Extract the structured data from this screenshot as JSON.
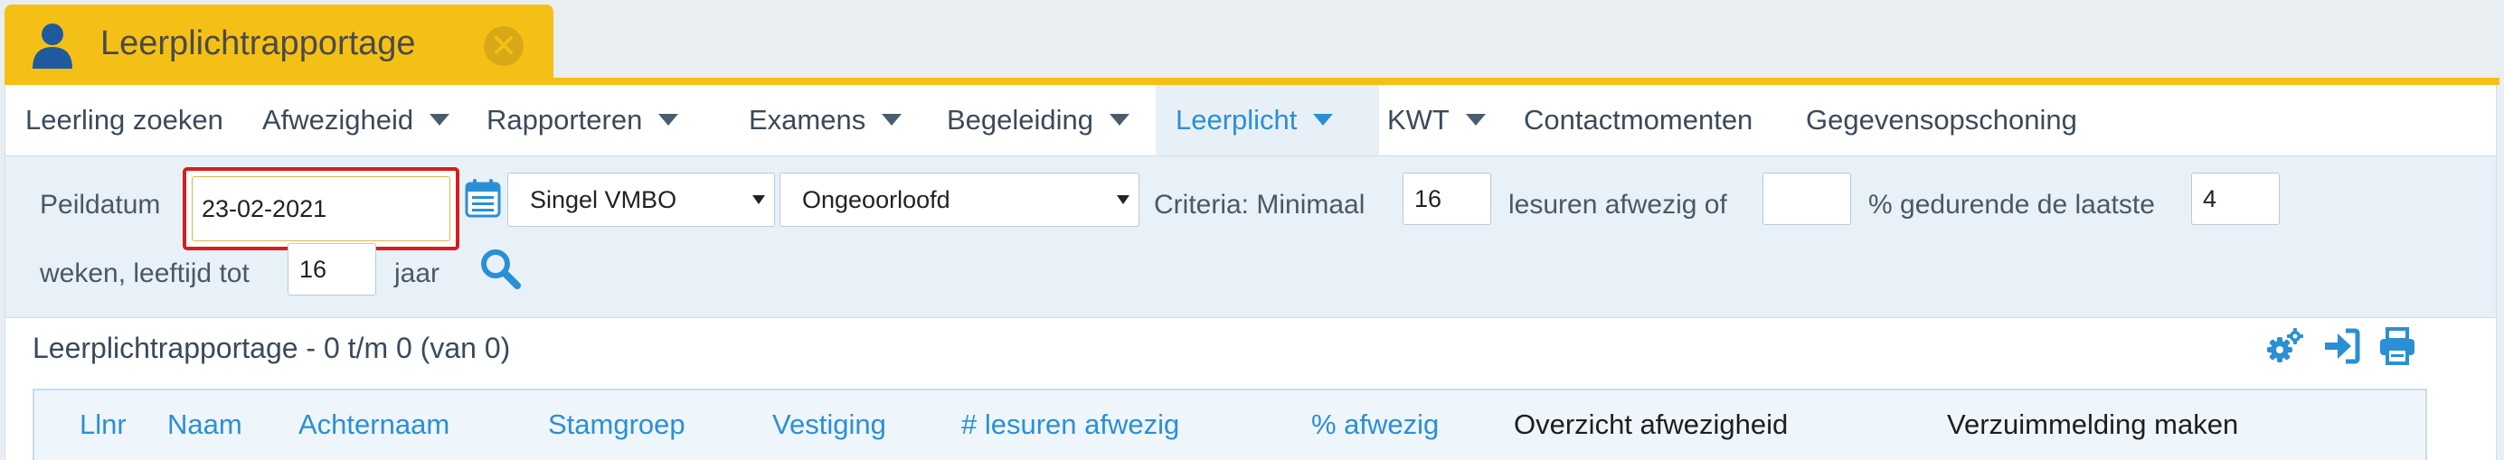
{
  "window": {
    "title": "Leerplichtrapportage"
  },
  "menu": {
    "items": [
      {
        "label": "Leerling zoeken",
        "dropdown": false,
        "active": false
      },
      {
        "label": "Afwezigheid",
        "dropdown": true,
        "active": false
      },
      {
        "label": "Rapporteren",
        "dropdown": true,
        "active": false
      },
      {
        "label": "Examens",
        "dropdown": true,
        "active": false
      },
      {
        "label": "Begeleiding",
        "dropdown": true,
        "active": false
      },
      {
        "label": "Leerplicht",
        "dropdown": true,
        "active": true
      },
      {
        "label": "KWT",
        "dropdown": true,
        "active": false
      },
      {
        "label": "Contactmomenten",
        "dropdown": false,
        "active": false
      },
      {
        "label": "Gegevensopschoning",
        "dropdown": false,
        "active": false
      }
    ]
  },
  "filter": {
    "peildatum_label": "Peildatum",
    "peildatum_value": "23-02-2021",
    "vestiging_value": "Singel VMBO",
    "type_value": "Ongeoorloofd",
    "criteria_label": "Criteria: Minimaal",
    "min_lesuren_value": "16",
    "lesuren_label": "lesuren afwezig of",
    "percent_value": "",
    "percent_label": "% gedurende de laatste",
    "weeks_value": "4",
    "weeks_label": "weken, leeftijd tot",
    "age_value": "16",
    "age_label": "jaar"
  },
  "results": {
    "title": "Leerplichtrapportage - 0 t/m 0 (van 0)",
    "columns": [
      "Llnr",
      "Naam",
      "Achternaam",
      "Stamgroep",
      "Vestiging",
      "# lesuren afwezig",
      "% afwezig",
      "Overzicht afwezigheid",
      "Verzuimmelding maken"
    ]
  },
  "colors": {
    "tab": "#f5c016",
    "accent": "#2b8fd6",
    "highlight_border": "#d91c1c"
  },
  "icons": [
    "user-icon",
    "close-icon",
    "calendar-icon",
    "search-icon",
    "settings-icon",
    "export-icon",
    "print-icon"
  ]
}
